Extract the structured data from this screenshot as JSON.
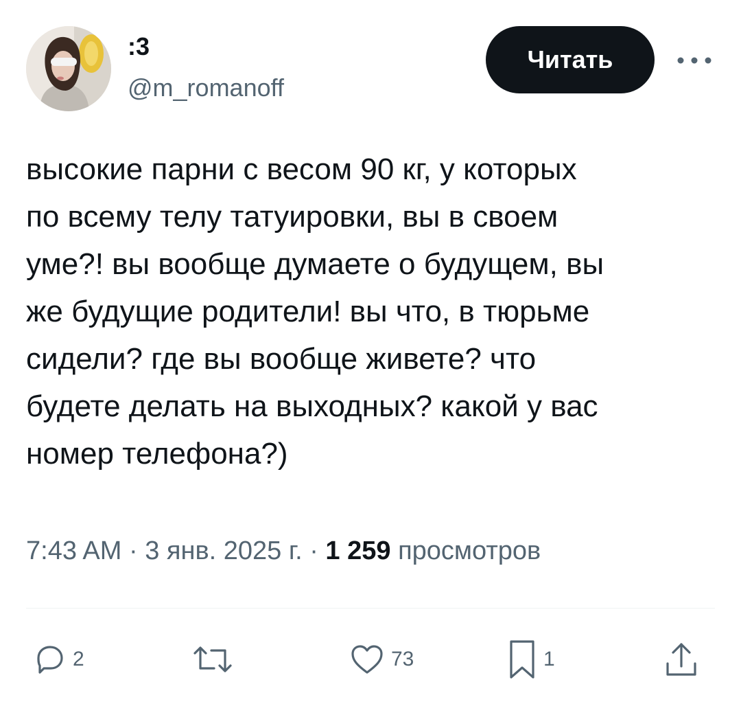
{
  "post": {
    "author": {
      "display_name": ":3",
      "handle": "@m_romanoff"
    },
    "follow_label": "Читать",
    "text": "высокие парни с весом 90 кг, у которых\nпо всему телу татуировки, вы в своем\nуме?! вы вообще думаете о будущем, вы\nже будущие родители! вы что, в тюрьме\nсидели? где вы вообще живете? что\nбудете делать на выходных? какой у вас\nномер телефона?)",
    "time": "7:43 AM",
    "separator": "·",
    "date": "3 янв. 2025 г.",
    "views_count": "1 259",
    "views_label": "просмотров"
  },
  "actions": {
    "replies": {
      "icon": "reply-icon",
      "count": "2"
    },
    "reposts": {
      "icon": "repost-icon",
      "count": ""
    },
    "likes": {
      "icon": "heart-icon",
      "count": "73"
    },
    "bookmarks": {
      "icon": "bookmark-icon",
      "count": "1"
    },
    "share": {
      "icon": "share-icon"
    }
  },
  "colors": {
    "text_primary": "#0f1419",
    "text_secondary": "#536471",
    "button_bg": "#0f1419",
    "button_text": "#ffffff",
    "divider": "#eff3f4"
  }
}
